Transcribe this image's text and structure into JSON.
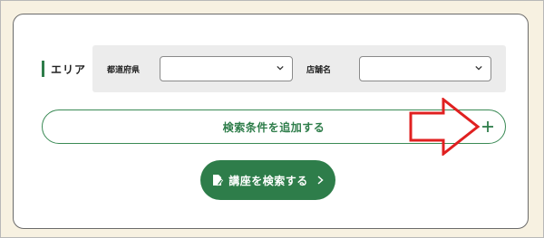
{
  "area": {
    "label": "エリア"
  },
  "filters": {
    "prefecture": {
      "label": "都道府県",
      "value": ""
    },
    "store": {
      "label": "店舗名",
      "value": ""
    }
  },
  "add_condition": {
    "label": "検索条件を追加する",
    "icon": "plus-icon"
  },
  "search_button": {
    "label": "講座を検索する",
    "icon": "document-pen-icon",
    "trailing_icon": "chevron-right-icon"
  },
  "annotation": {
    "icon": "red-arrow-annotation",
    "color": "#e02020"
  },
  "colors": {
    "accent": "#2e7d4a",
    "background": "#f7f1e1"
  }
}
